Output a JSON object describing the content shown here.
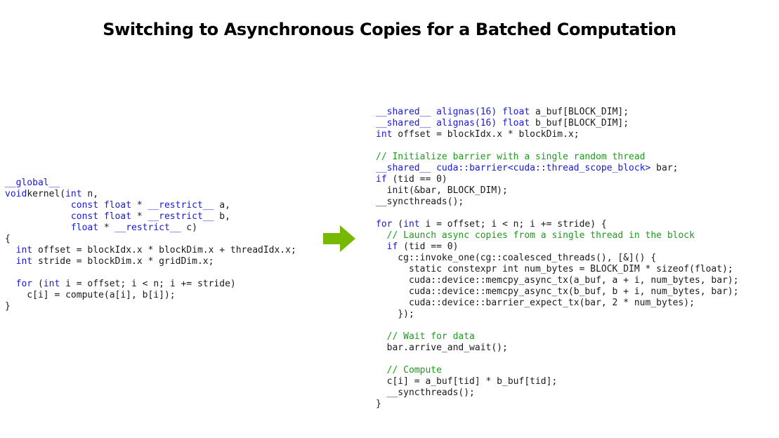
{
  "title": "Switching to Asynchronous Copies for a Batched Computation",
  "colors": {
    "keyword": "#1a1acc",
    "comment": "#1e9a1e",
    "arrow": "#76b900"
  },
  "arrow_icon": "right-arrow-icon",
  "left_code": [
    [
      [
        "kw",
        "__global__"
      ]
    ],
    [
      [
        "kw",
        "void"
      ],
      [
        "",
        "kernel("
      ],
      [
        "kw",
        "int"
      ],
      [
        "",
        " n,"
      ]
    ],
    [
      [
        "",
        "            "
      ],
      [
        "kw",
        "const float"
      ],
      [
        "",
        ""
      ],
      [
        "",
        " * "
      ],
      [
        "kw",
        "__restrict__"
      ],
      [
        "",
        " a,"
      ]
    ],
    [
      [
        "",
        "            "
      ],
      [
        "kw",
        "const float"
      ],
      [
        "",
        " * "
      ],
      [
        "kw",
        "__restrict__"
      ],
      [
        "",
        " b,"
      ]
    ],
    [
      [
        "",
        "            "
      ],
      [
        "kw",
        "float"
      ],
      [
        "",
        " * "
      ],
      [
        "kw",
        "__restrict__"
      ],
      [
        "",
        " c)"
      ]
    ],
    [
      [
        "",
        "{"
      ]
    ],
    [
      [
        "",
        "  "
      ],
      [
        "kw",
        "int"
      ],
      [
        "",
        " offset = blockIdx.x * blockDim.x + threadIdx.x;"
      ]
    ],
    [
      [
        "",
        "  "
      ],
      [
        "kw",
        "int"
      ],
      [
        "",
        " stride = blockDim.x * gridDim.x;"
      ]
    ],
    [
      [
        "",
        ""
      ]
    ],
    [
      [
        "",
        "  "
      ],
      [
        "kw",
        "for"
      ],
      [
        "",
        " ("
      ],
      [
        "kw",
        "int"
      ],
      [
        "",
        " i = offset; i < n; i += stride)"
      ]
    ],
    [
      [
        "",
        "    c[i] = compute(a[i], b[i]);"
      ]
    ],
    [
      [
        "",
        "}"
      ]
    ]
  ],
  "right_code": [
    [
      [
        "kw",
        "__shared__"
      ],
      [
        "",
        " "
      ],
      [
        "kw",
        "alignas(16)"
      ],
      [
        "",
        " "
      ],
      [
        "kw",
        "float"
      ],
      [
        "",
        " a_buf[BLOCK_DIM];"
      ]
    ],
    [
      [
        "kw",
        "__shared__"
      ],
      [
        "",
        " "
      ],
      [
        "kw",
        "alignas(16)"
      ],
      [
        "",
        " "
      ],
      [
        "kw",
        "float"
      ],
      [
        "",
        " b_buf[BLOCK_DIM];"
      ]
    ],
    [
      [
        "kw",
        "int"
      ],
      [
        "",
        " offset = blockIdx.x * blockDim.x;"
      ]
    ],
    [
      [
        "",
        ""
      ]
    ],
    [
      [
        "cm",
        "// Initialize barrier with a single random thread"
      ]
    ],
    [
      [
        "kw",
        "__shared__"
      ],
      [
        "",
        " "
      ],
      [
        "kw",
        "cuda::barrier<cuda::thread_scope_block>"
      ],
      [
        "",
        " bar;"
      ]
    ],
    [
      [
        "kw",
        "if"
      ],
      [
        "",
        " (tid == 0)"
      ]
    ],
    [
      [
        "",
        "  init(&bar, BLOCK_DIM);"
      ]
    ],
    [
      [
        "",
        "__syncthreads();"
      ]
    ],
    [
      [
        "",
        ""
      ]
    ],
    [
      [
        "kw",
        "for"
      ],
      [
        "",
        " ("
      ],
      [
        "kw",
        "int"
      ],
      [
        "",
        " i = offset; i < n; i += stride) {"
      ]
    ],
    [
      [
        "",
        "  "
      ],
      [
        "cm",
        "// Launch async copies from a single thread in the block"
      ]
    ],
    [
      [
        "",
        "  "
      ],
      [
        "kw",
        "if"
      ],
      [
        "",
        " (tid == 0)"
      ]
    ],
    [
      [
        "",
        "    cg::invoke_one(cg::coalesced_threads(), [&]() {"
      ]
    ],
    [
      [
        "",
        "      static constexpr int num_bytes = BLOCK_DIM * sizeof(float);"
      ]
    ],
    [
      [
        "",
        "      cuda::device::memcpy_async_tx(a_buf, a + i, num_bytes, bar);"
      ]
    ],
    [
      [
        "",
        "      cuda::device::memcpy_async_tx(b_buf, b + i, num_bytes, bar);"
      ]
    ],
    [
      [
        "",
        "      cuda::device::barrier_expect_tx(bar, 2 * num_bytes);"
      ]
    ],
    [
      [
        "",
        "    });"
      ]
    ],
    [
      [
        "",
        ""
      ]
    ],
    [
      [
        "",
        "  "
      ],
      [
        "cm",
        "// Wait for data"
      ]
    ],
    [
      [
        "",
        "  bar.arrive_and_wait();"
      ]
    ],
    [
      [
        "",
        ""
      ]
    ],
    [
      [
        "",
        "  "
      ],
      [
        "cm",
        "// Compute"
      ]
    ],
    [
      [
        "",
        "  c[i] = a_buf[tid] * b_buf[tid];"
      ]
    ],
    [
      [
        "",
        "  __syncthreads();"
      ]
    ],
    [
      [
        "",
        "}"
      ]
    ]
  ]
}
